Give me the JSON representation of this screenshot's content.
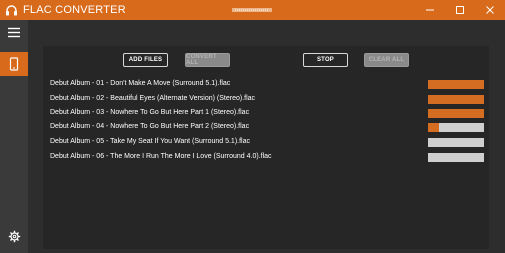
{
  "app": {
    "title": "FLAC CONVERTER"
  },
  "toolbar": {
    "add_files": "ADD FILES",
    "convert_all": "CONVERT ALL",
    "stop": "STOP",
    "clear_all": "CLEAR ALL"
  },
  "files": [
    {
      "name": "Debut Album - 01 - Don't Make A Move (Surround 5.1).flac",
      "progress": 1.0
    },
    {
      "name": "Debut Album - 02 - Beautiful Eyes (Alternate Version) (Stereo).flac",
      "progress": 1.0
    },
    {
      "name": "Debut Album - 03 - Nowhere To Go But Here Part 1 (Stereo).flac",
      "progress": 1.0
    },
    {
      "name": "Debut Album - 04 - Nowhere To Go But Here Part 2 (Stereo).flac",
      "progress": 0.2
    },
    {
      "name": "Debut Album - 05 - Take My Seat If You Want (Surround 5.1).flac",
      "progress": 0.0
    },
    {
      "name": "Debut Album - 06 - The More I Run The More I Love (Surround 4.0).flac",
      "progress": 0.0
    }
  ],
  "icons": {
    "app": "headphones-icon",
    "menu": "hamburger-menu-icon",
    "device": "phone-icon",
    "settings": "gear-icon"
  },
  "colors": {
    "accent": "#d86a1c",
    "progress_fill": "#d46c22",
    "progress_track": "#cfcfcf"
  }
}
